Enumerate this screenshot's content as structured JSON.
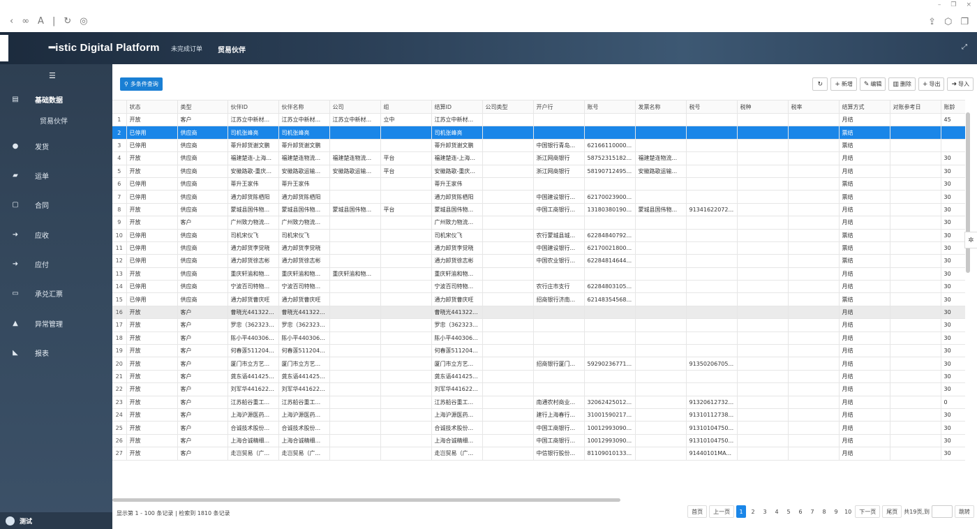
{
  "app": {
    "brand": "━istic Digital Platform",
    "topnav": [
      {
        "label": "未完成订单"
      },
      {
        "label": "贸易伙伴"
      }
    ]
  },
  "sidebar": {
    "groups": [
      {
        "label": "基础数据",
        "icon": "database-icon",
        "glyph": "☰"
      },
      {
        "label": "发货",
        "icon": "circle-icon",
        "glyph": "●"
      },
      {
        "label": "运单",
        "icon": "truck-icon",
        "glyph": "▰"
      },
      {
        "label": "合同",
        "icon": "document-icon",
        "glyph": "▢"
      },
      {
        "label": "应收",
        "icon": "sign-in-icon",
        "glyph": "➜"
      },
      {
        "label": "应付",
        "icon": "sign-out-icon",
        "glyph": "➜"
      },
      {
        "label": "承兑汇票",
        "icon": "card-icon",
        "glyph": "▭"
      },
      {
        "label": "异常管理",
        "icon": "bell-icon",
        "glyph": "▲"
      },
      {
        "label": "报表",
        "icon": "area-chart-icon",
        "glyph": "◣"
      }
    ],
    "sub_items": [
      {
        "label": "贸易伙伴"
      }
    ],
    "user": "测试"
  },
  "toolbar": {
    "query": "多条件查询",
    "add": "新增",
    "edit": "编辑",
    "delete": "删除",
    "export": "导出",
    "import": "导入"
  },
  "table": {
    "columns": [
      "",
      "状态",
      "类型",
      "伙伴ID",
      "伙伴名称",
      "公司",
      "组",
      "结算ID",
      "公司类型",
      "开户行",
      "账号",
      "发票名称",
      "税号",
      "税种",
      "税率",
      "结算方式",
      "对账参考日",
      "账龄"
    ],
    "rows": [
      [
        "1",
        "开放",
        "客户",
        "江苏立中新材...",
        "江苏立中新材...",
        "江苏立中新材...",
        "立中",
        "江苏立中新材...",
        "",
        "",
        "",
        "",
        "",
        "",
        "",
        "月结",
        "",
        "45"
      ],
      [
        "2",
        "已停用",
        "供应商",
        "司机张峰亮",
        "司机张峰亮",
        "",
        "",
        "司机张峰亮",
        "",
        "",
        "",
        "",
        "",
        "",
        "",
        "票结",
        "",
        ""
      ],
      [
        "3",
        "已停用",
        "供应商",
        "蒂升卸货谢文鹏",
        "蒂升卸货谢文鹏",
        "",
        "",
        "蒂升卸货谢文鹏",
        "",
        "中国银行青岛...",
        "62166110000...",
        "",
        "",
        "",
        "",
        "票结",
        "",
        ""
      ],
      [
        "4",
        "开放",
        "供应商",
        "福建楚连-上海...",
        "福建楚连物流...",
        "福建楚连物流...",
        "平台",
        "福建楚连-上海...",
        "",
        "浙江网商银行",
        "58752315182...",
        "福建楚连物流...",
        "",
        "",
        "",
        "月结",
        "",
        "30"
      ],
      [
        "5",
        "开放",
        "供应商",
        "安徽路歌-重庆...",
        "安徽路歌运输...",
        "安徽路歌运输...",
        "平台",
        "安徽路歌-重庆...",
        "",
        "浙江网商银行",
        "58190712495...",
        "安徽路歌运输...",
        "",
        "",
        "",
        "月结",
        "",
        "30"
      ],
      [
        "6",
        "已停用",
        "供应商",
        "蒂升王家伟",
        "蒂升王家伟",
        "",
        "",
        "蒂升王家伟",
        "",
        "",
        "",
        "",
        "",
        "",
        "",
        "票结",
        "",
        "30"
      ],
      [
        "7",
        "已停用",
        "供应商",
        "通力卸货陈栖阳",
        "通力卸货陈栖阳",
        "",
        "",
        "通力卸货陈栖阳",
        "",
        "中国建设银行...",
        "62170023900...",
        "",
        "",
        "",
        "",
        "票结",
        "",
        "30"
      ],
      [
        "8",
        "开放",
        "供应商",
        "蒙城县国伟物...",
        "蒙城县国伟物...",
        "蒙城县国伟物...",
        "平台",
        "蒙城县国伟物...",
        "",
        "中国工商银行...",
        "13180380190...",
        "蒙城县国伟物...",
        "91341622072...",
        "",
        "",
        "月结",
        "",
        "30"
      ],
      [
        "9",
        "开放",
        "客户",
        "广州致力物流...",
        "广州致力物流...",
        "",
        "",
        "广州致力物流...",
        "",
        "",
        "",
        "",
        "",
        "",
        "",
        "月结",
        "",
        "30"
      ],
      [
        "10",
        "已停用",
        "供应商",
        "司机宋仪飞",
        "司机宋仪飞",
        "",
        "",
        "司机宋仪飞",
        "",
        "农行蒙城县城...",
        "62284840792...",
        "",
        "",
        "",
        "",
        "票结",
        "",
        "30"
      ],
      [
        "11",
        "已停用",
        "供应商",
        "通力卸货李觉晓",
        "通力卸货李觉晓",
        "",
        "",
        "通力卸货李觉晓",
        "",
        "中国建设银行...",
        "62170021800...",
        "",
        "",
        "",
        "",
        "票结",
        "",
        "30"
      ],
      [
        "12",
        "已停用",
        "供应商",
        "通力卸货徐志彬",
        "通力卸货徐志彬",
        "",
        "",
        "通力卸货徐志彬",
        "",
        "中国农业银行...",
        "62284814644...",
        "",
        "",
        "",
        "",
        "票结",
        "",
        "30"
      ],
      [
        "13",
        "开放",
        "供应商",
        "重庆轩渝和物...",
        "重庆轩渝和物...",
        "重庆轩渝和物...",
        "",
        "重庆轩渝和物...",
        "",
        "",
        "",
        "",
        "",
        "",
        "",
        "月结",
        "",
        "30"
      ],
      [
        "14",
        "已停用",
        "供应商",
        "宁波百司特物...",
        "宁波百司特物...",
        "",
        "",
        "宁波百司特物...",
        "",
        "农行庄市支行",
        "62284803105...",
        "",
        "",
        "",
        "",
        "月结",
        "",
        "30"
      ],
      [
        "15",
        "已停用",
        "供应商",
        "通力卸货曹庆旺",
        "通力卸货曹庆旺",
        "",
        "",
        "通力卸货曹庆旺",
        "",
        "招商银行济南...",
        "62148354568...",
        "",
        "",
        "",
        "",
        "票结",
        "",
        "30"
      ],
      [
        "16",
        "开放",
        "客户",
        "曹晓光441322...",
        "曹晓光441322...",
        "",
        "",
        "曹晓光441322...",
        "",
        "",
        "",
        "",
        "",
        "",
        "",
        "月结",
        "",
        "30"
      ],
      [
        "17",
        "开放",
        "客户",
        "罗忠（362323...",
        "罗忠（362323...",
        "",
        "",
        "罗忠（362323...",
        "",
        "",
        "",
        "",
        "",
        "",
        "",
        "月结",
        "",
        "30"
      ],
      [
        "18",
        "开放",
        "客户",
        "陈小平440306...",
        "陈小平440306...",
        "",
        "",
        "陈小平440306...",
        "",
        "",
        "",
        "",
        "",
        "",
        "",
        "月结",
        "",
        "30"
      ],
      [
        "19",
        "开放",
        "客户",
        "何春莲511204...",
        "何春莲511204...",
        "",
        "",
        "何春莲511204...",
        "",
        "",
        "",
        "",
        "",
        "",
        "",
        "月结",
        "",
        "30"
      ],
      [
        "20",
        "开放",
        "客户",
        "厦门市立方艺...",
        "厦门市立方艺...",
        "",
        "",
        "厦门市立方艺...",
        "",
        "招商银行厦门...",
        "59290236771...",
        "",
        "91350206705...",
        "",
        "",
        "月结",
        "",
        "30"
      ],
      [
        "21",
        "开放",
        "客户",
        "龚东语441425...",
        "龚东语441425...",
        "",
        "",
        "龚东语441425...",
        "",
        "",
        "",
        "",
        "",
        "",
        "",
        "月结",
        "",
        "30"
      ],
      [
        "22",
        "开放",
        "客户",
        "刘军华441622...",
        "刘军华441622...",
        "",
        "",
        "刘军华441622...",
        "",
        "",
        "",
        "",
        "",
        "",
        "",
        "月结",
        "",
        "30"
      ],
      [
        "23",
        "开放",
        "客户",
        "江苏船谷重工...",
        "江苏船谷重工...",
        "",
        "",
        "江苏船谷重工...",
        "",
        "南通农村商业...",
        "32062425012...",
        "",
        "91320612732...",
        "",
        "",
        "月结",
        "",
        "0"
      ],
      [
        "24",
        "开放",
        "客户",
        "上海沪源医药...",
        "上海沪源医药...",
        "",
        "",
        "上海沪源医药...",
        "",
        "建行上海春行...",
        "31001590217...",
        "",
        "91310112738...",
        "",
        "",
        "月结",
        "",
        "30"
      ],
      [
        "25",
        "开放",
        "客户",
        "合诚技术股份...",
        "合诚技术股份...",
        "",
        "",
        "合诚技术股份...",
        "",
        "中国工商银行...",
        "10012993090...",
        "",
        "91310104750...",
        "",
        "",
        "月结",
        "",
        "30"
      ],
      [
        "26",
        "开放",
        "客户",
        "上海合诚精细...",
        "上海合诚精细...",
        "",
        "",
        "上海合诚精细...",
        "",
        "中国工商银行...",
        "10012993090...",
        "",
        "91310104750...",
        "",
        "",
        "月结",
        "",
        "30"
      ],
      [
        "27",
        "开放",
        "客户",
        "走岂贸易（广...",
        "走岂贸易（广...",
        "",
        "",
        "走岂贸易（广...",
        "",
        "中信银行股份...",
        "81109010133...",
        "",
        "91440101MA...",
        "",
        "",
        "月结",
        "",
        "30"
      ]
    ],
    "selected_row": 2,
    "hover_row": 16
  },
  "pager": {
    "info": "显示第 1 - 100 条记录 | 检索到 1810 条记录",
    "first": "首页",
    "prev": "上一页",
    "pages": [
      "1",
      "2",
      "3",
      "4",
      "5",
      "6",
      "7",
      "8",
      "9",
      "10"
    ],
    "current": "1",
    "next": "下一页",
    "last": "尾页",
    "total": "共19页,到",
    "jump": "跳转"
  },
  "colors": {
    "accent": "#1a86e8",
    "header_bg": "#2a3e55",
    "sidebar_bg": "#35495e"
  }
}
